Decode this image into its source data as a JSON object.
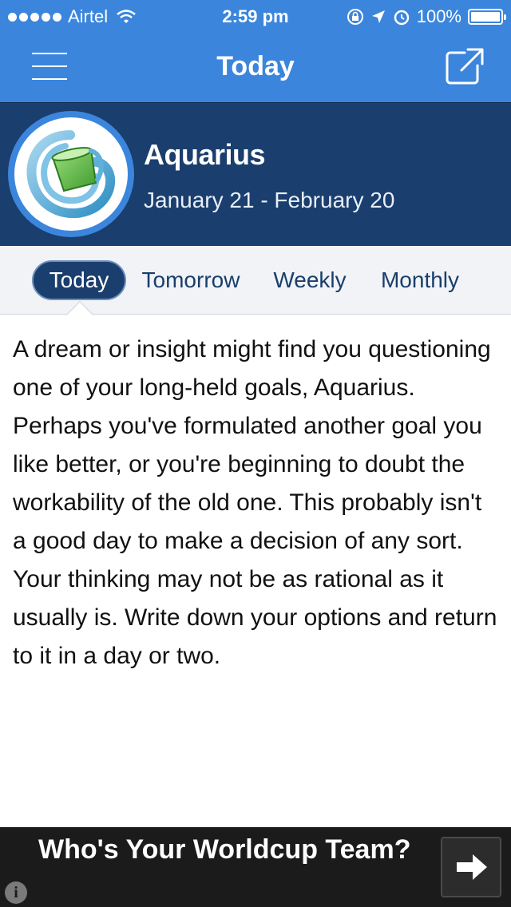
{
  "status_bar": {
    "carrier": "Airtel",
    "time": "2:59 pm",
    "battery": "100%"
  },
  "nav": {
    "title": "Today",
    "menu_icon": "hamburger-menu-icon",
    "share_icon": "external-share-icon"
  },
  "sign": {
    "name": "Aquarius",
    "dates": "January 21 - February 20",
    "logo_icon": "aquarius-water-bearer-icon"
  },
  "tabs": [
    {
      "label": "Today",
      "active": true
    },
    {
      "label": "Tomorrow",
      "active": false
    },
    {
      "label": "Weekly",
      "active": false
    },
    {
      "label": "Monthly",
      "active": false
    }
  ],
  "horoscope": {
    "text": "A dream or insight might find you questioning one of your long-held goals, Aquarius. Perhaps you've formulated another goal you like better, or you're beginning to doubt the workability of the old one. This probably isn't a good day to make a decision of any sort. Your thinking may not be as rational as it usually is. Write down your options and return to it in a day or two."
  },
  "ad": {
    "text": "Who's Your Worldcup Team?",
    "info_icon": "info-icon",
    "arrow_icon": "arrow-right-icon"
  },
  "colors": {
    "nav_blue": "#3b86dc",
    "header_navy": "#1a3e6d",
    "tab_bar": "#f1f3f6",
    "ad_bg": "#1b1b1b"
  }
}
